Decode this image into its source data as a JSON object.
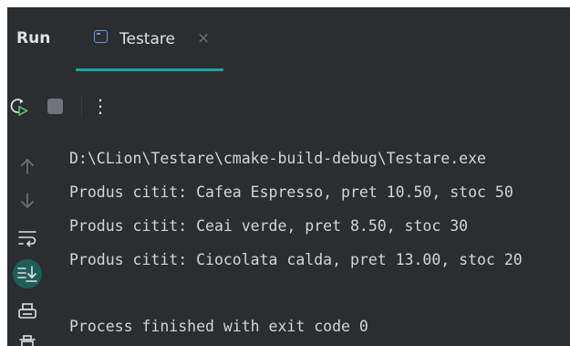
{
  "run_panel": {
    "title": "Run",
    "tab": {
      "label": "Testare",
      "close_glyph": "×",
      "icon": "console-window-icon"
    },
    "toolbar": {
      "rerun_icon": "rerun-icon",
      "stop_icon": "stop-icon",
      "more_glyph": "⋮"
    },
    "sidebar_icons": [
      "arrow-up-icon",
      "arrow-down-icon",
      "soft-wrap-icon",
      "scroll-to-end-icon",
      "print-icon",
      "clear-all-icon"
    ],
    "console_lines": [
      "D:\\CLion\\Testare\\cmake-build-debug\\Testare.exe",
      "Produs citit: Cafea Espresso, pret 10.50, stoc 50",
      "Produs citit: Ceai verde, pret 8.50, stoc 30",
      "Produs citit: Ciocolata calda, pret 13.00, stoc 20",
      "",
      "Process finished with exit code 0"
    ]
  },
  "colors": {
    "panel_bg": "#2b2d30",
    "text": "#dfe1e5",
    "console_text": "#d3d5d8",
    "accent_teal": "#1fa59d",
    "active_icon_bg": "#1e5e59",
    "icon_gray": "#6f737a",
    "tab_icon_blue": "#5e9ce6",
    "rerun_green": "#5fb865"
  }
}
